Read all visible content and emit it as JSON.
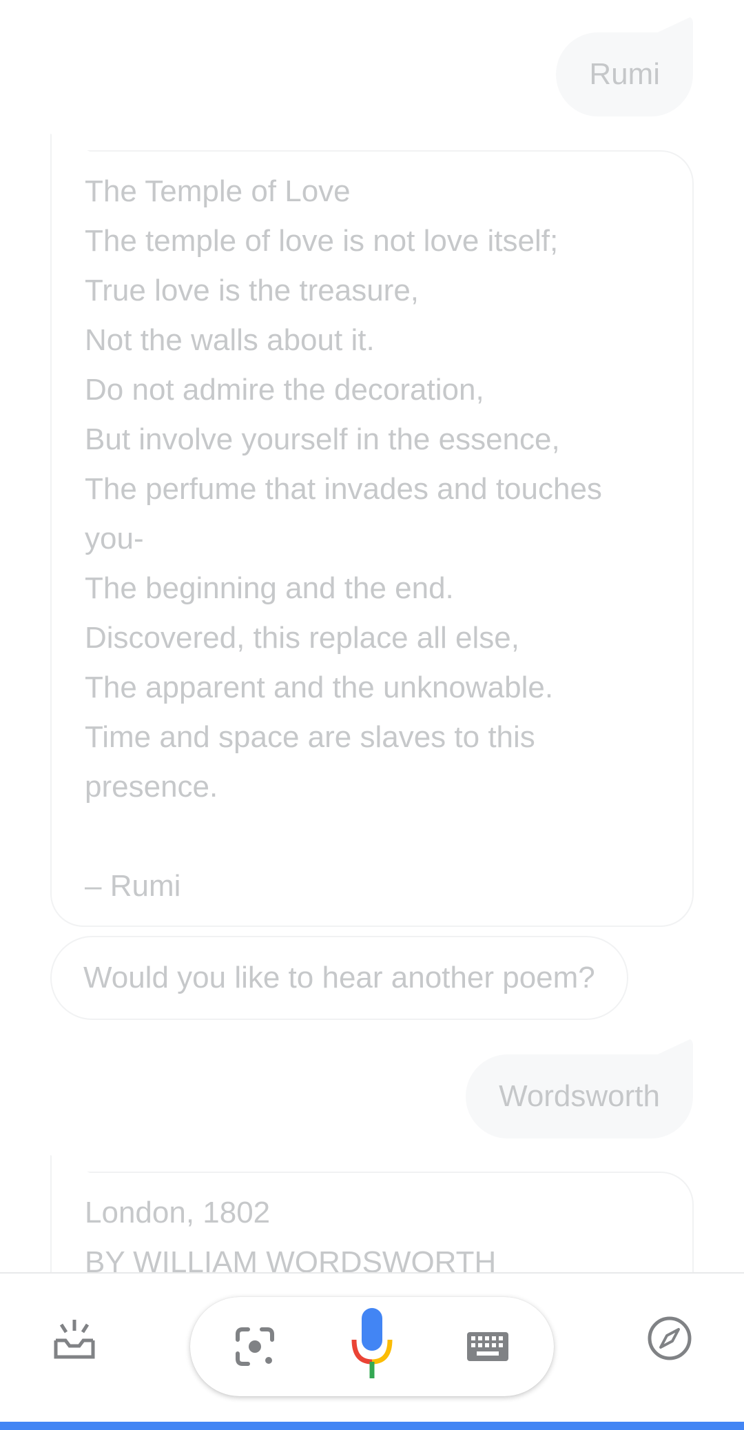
{
  "conversation": {
    "user_messages": [
      "Rumi",
      "Wordsworth"
    ],
    "poem1": {
      "lines": [
        "The Temple of Love",
        "The temple of love is not love itself;",
        "True love is the treasure,",
        "Not the walls about it.",
        "Do not admire the decoration,",
        "But involve yourself in the essence,",
        "The perfume that invades and touches you-",
        "The beginning and the end.",
        "Discovered, this replace all else,",
        "The apparent and the unknowable.",
        "Time and space are slaves to this presence.",
        "",
        "– Rumi"
      ]
    },
    "followup_prompt": "Would you like to hear another poem?",
    "poem2": {
      "lines": [
        "London, 1802",
        "BY WILLIAM WORDSWORTH"
      ]
    }
  },
  "bottom_bar": {
    "updates_icon": "snapshot-tray-icon",
    "lens_icon": "lens-icon",
    "mic_icon": "microphone-icon",
    "keyboard_icon": "keyboard-icon",
    "explore_icon": "compass-icon"
  },
  "colors": {
    "accent_blue": "#4285F4",
    "mic_red": "#EA4335",
    "mic_yellow": "#FBBC05",
    "mic_green": "#34A853",
    "icon_gray": "#808285"
  }
}
